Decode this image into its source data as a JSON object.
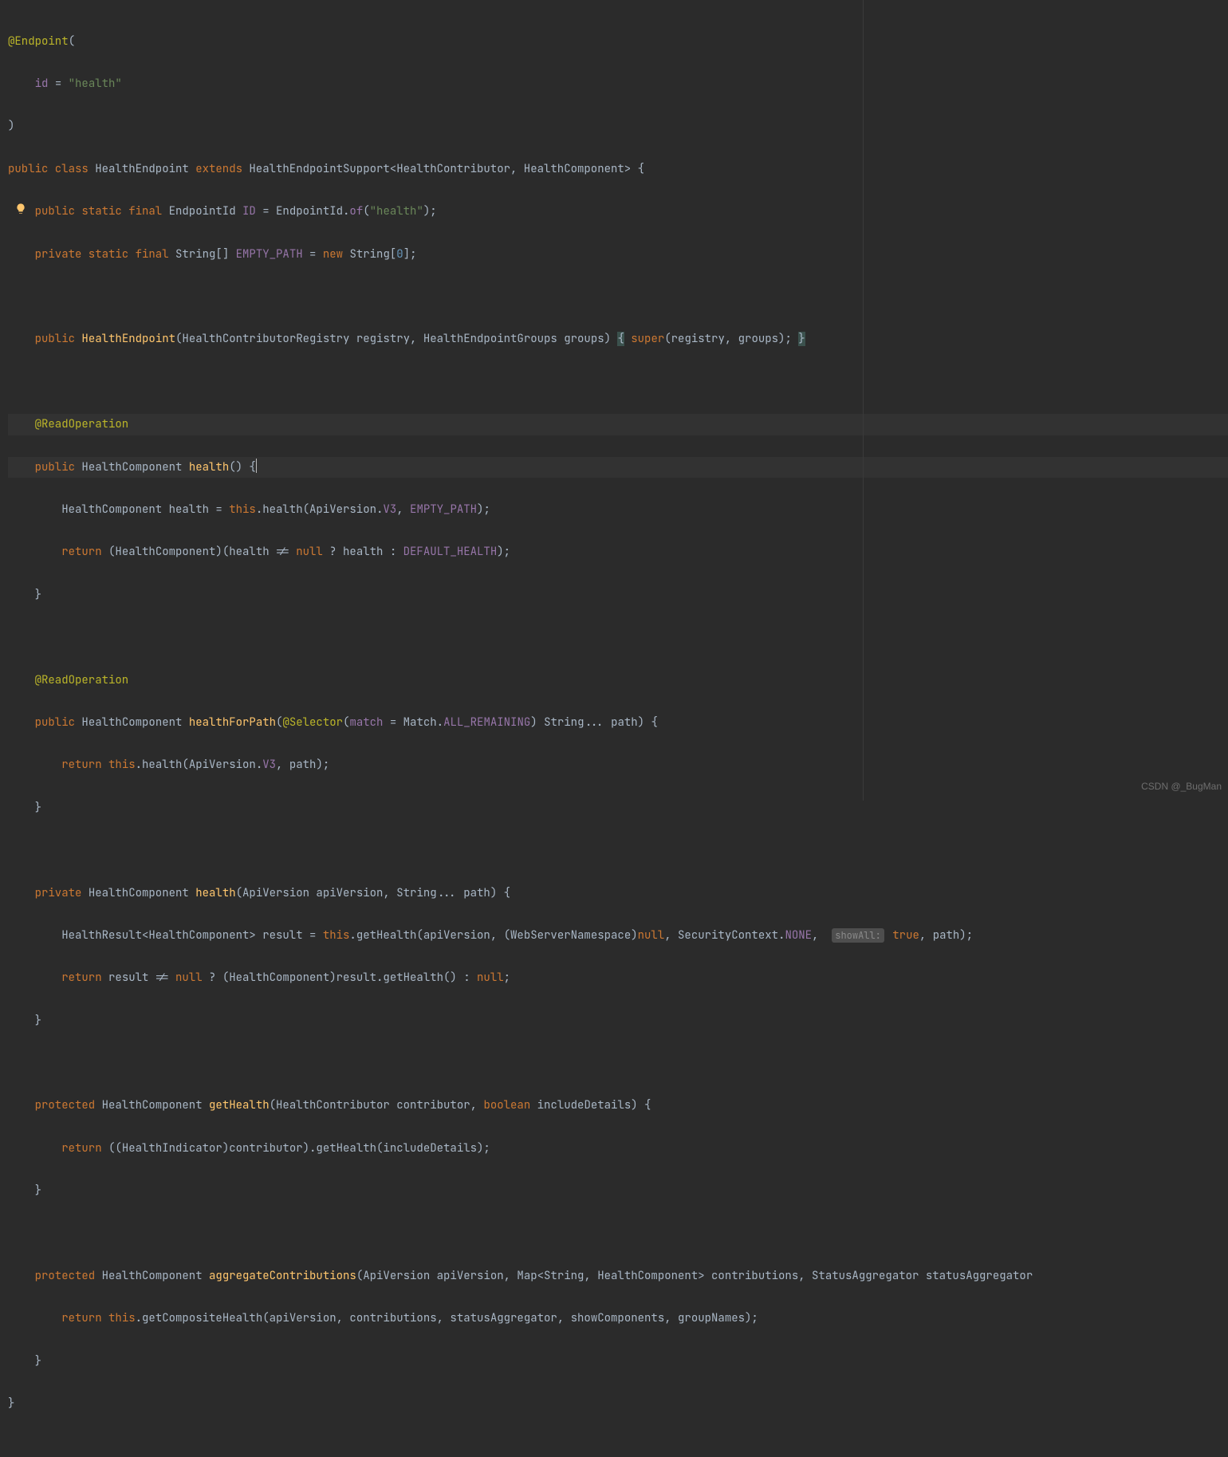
{
  "colors": {
    "bg": "#2b2b2b",
    "fg": "#a9b7c6",
    "kw": "#cc7832",
    "str": "#6a8759",
    "num": "#6897bb",
    "ann": "#bbb529",
    "fld": "#9876aa",
    "mth": "#ffc66d",
    "hint_bg": "#4e4e4e",
    "hint_fg": "#8a8a8a",
    "line_hl": "#323232"
  },
  "gutter": {
    "bulb_icon": "lightbulb-icon"
  },
  "hint": {
    "showAll": "showAll:"
  },
  "watermark": "CSDN @_BugMan",
  "code": {
    "l1": {
      "a": "@Endpoint",
      "b": "("
    },
    "l2": {
      "a": "id",
      "b": " = ",
      "c": "\"health\""
    },
    "l3": {
      "a": ")"
    },
    "l4": {
      "a": "public class ",
      "b": "HealthEndpoint ",
      "c": "extends ",
      "d": "HealthEndpointSupport<HealthContributor, HealthComponent> {"
    },
    "l5": {
      "a": "public static final ",
      "b": "EndpointId ",
      "c": "ID ",
      "d": "= EndpointId.",
      "e": "of",
      "f": "(",
      "g": "\"health\"",
      "h": ");"
    },
    "l6": {
      "a": "private static final ",
      "b": "String[] ",
      "c": "EMPTY_PATH ",
      "d": "= ",
      "e": "new ",
      "f": "String[",
      "g": "0",
      "h": "];"
    },
    "l7": {
      "a": "public ",
      "b": "HealthEndpoint",
      "c": "(HealthContributorRegistry registry, HealthEndpointGroups groups) ",
      "d": "{",
      "e": " ",
      "f": "super",
      "g": "(registry, groups); ",
      "h": "}"
    },
    "l8": {
      "a": "@ReadOperation"
    },
    "l9": {
      "a": "public ",
      "b": "HealthComponent ",
      "c": "health",
      "d": "() {"
    },
    "l10": {
      "a": "HealthComponent health = ",
      "b": "this",
      "c": ".health(ApiVersion.",
      "d": "V3",
      "e": ", ",
      "f": "EMPTY_PATH",
      "g": ");"
    },
    "l11": {
      "a": "return ",
      "b": "(HealthComponent)(health != ",
      "c": "null ",
      "d": "? health : ",
      "e": "DEFAULT_HEALTH",
      "f": ");"
    },
    "l12": {
      "a": "}"
    },
    "l13": {
      "a": "@ReadOperation"
    },
    "l14": {
      "a": "public ",
      "b": "HealthComponent ",
      "c": "healthForPath",
      "d": "(",
      "e": "@Selector",
      "f": "(",
      "g": "match ",
      "h": "= Match.",
      "i": "ALL_REMAINING",
      "j": ") String... path) {"
    },
    "l15": {
      "a": "return ",
      "b": "this",
      "c": ".health(ApiVersion.",
      "d": "V3",
      "e": ", path);"
    },
    "l16": {
      "a": "}"
    },
    "l17": {
      "a": "private ",
      "b": "HealthComponent ",
      "c": "health",
      "d": "(ApiVersion apiVersion, String... path) {"
    },
    "l18": {
      "a": "HealthResult<HealthComponent> result = ",
      "b": "this",
      "c": ".getHealth(apiVersion, (WebServerNamespace)",
      "d": "null",
      "e": ", SecurityContext.",
      "f": "NONE",
      "g": ", ",
      "h": "true",
      "i": ", path);"
    },
    "l19": {
      "a": "return ",
      "b": "result != ",
      "c": "null ",
      "d": "? (HealthComponent)result.getHealth() : ",
      "e": "null",
      "f": ";"
    },
    "l20": {
      "a": "}"
    },
    "l21": {
      "a": "protected ",
      "b": "HealthComponent ",
      "c": "getHealth",
      "d": "(HealthContributor contributor, ",
      "e": "boolean ",
      "f": "includeDetails) {"
    },
    "l22": {
      "a": "return ",
      "b": "((HealthIndicator)contributor).getHealth(includeDetails);"
    },
    "l23": {
      "a": "}"
    },
    "l24": {
      "a": "protected ",
      "b": "HealthComponent ",
      "c": "aggregateContributions",
      "d": "(ApiVersion apiVersion, Map<String, HealthComponent> contributions, StatusAggregator statusAggregator"
    },
    "l25": {
      "a": "return ",
      "b": "this",
      "c": ".getCompositeHealth(apiVersion, contributions, statusAggregator, showComponents, groupNames);"
    },
    "l26": {
      "a": "}"
    },
    "l27": {
      "a": "}"
    }
  }
}
